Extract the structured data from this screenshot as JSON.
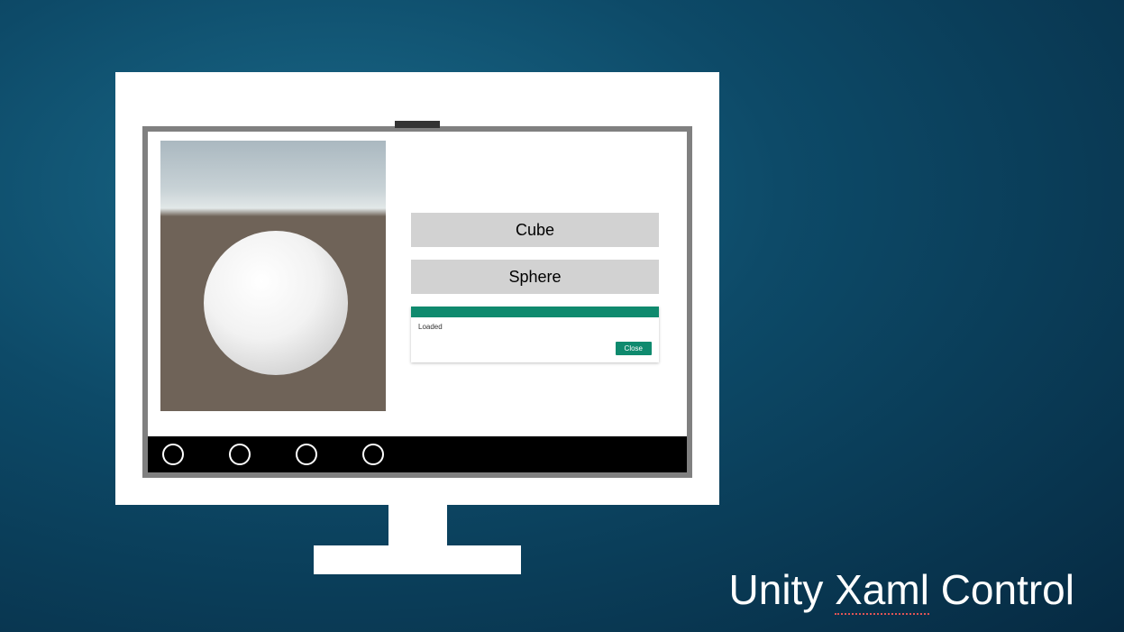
{
  "slide": {
    "title_prefix": "Unity ",
    "title_underlined": "Xaml",
    "title_suffix": " Control"
  },
  "xaml": {
    "buttons": {
      "cube": "Cube",
      "sphere": "Sphere"
    },
    "dialog": {
      "message": "Loaded",
      "close": "Close"
    }
  },
  "appbar": {
    "buttons": [
      "circle-1",
      "circle-2",
      "circle-3",
      "circle-4"
    ]
  }
}
